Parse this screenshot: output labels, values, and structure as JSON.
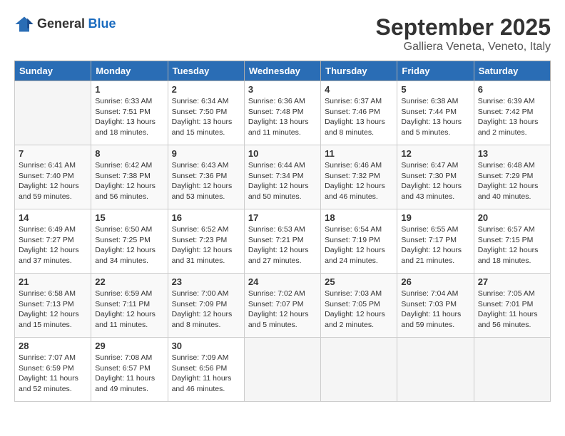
{
  "logo": {
    "general": "General",
    "blue": "Blue"
  },
  "title": "September 2025",
  "location": "Galliera Veneta, Veneto, Italy",
  "days_header": [
    "Sunday",
    "Monday",
    "Tuesday",
    "Wednesday",
    "Thursday",
    "Friday",
    "Saturday"
  ],
  "weeks": [
    [
      {
        "day": "",
        "info": ""
      },
      {
        "day": "1",
        "info": "Sunrise: 6:33 AM\nSunset: 7:51 PM\nDaylight: 13 hours\nand 18 minutes."
      },
      {
        "day": "2",
        "info": "Sunrise: 6:34 AM\nSunset: 7:50 PM\nDaylight: 13 hours\nand 15 minutes."
      },
      {
        "day": "3",
        "info": "Sunrise: 6:36 AM\nSunset: 7:48 PM\nDaylight: 13 hours\nand 11 minutes."
      },
      {
        "day": "4",
        "info": "Sunrise: 6:37 AM\nSunset: 7:46 PM\nDaylight: 13 hours\nand 8 minutes."
      },
      {
        "day": "5",
        "info": "Sunrise: 6:38 AM\nSunset: 7:44 PM\nDaylight: 13 hours\nand 5 minutes."
      },
      {
        "day": "6",
        "info": "Sunrise: 6:39 AM\nSunset: 7:42 PM\nDaylight: 13 hours\nand 2 minutes."
      }
    ],
    [
      {
        "day": "7",
        "info": "Sunrise: 6:41 AM\nSunset: 7:40 PM\nDaylight: 12 hours\nand 59 minutes."
      },
      {
        "day": "8",
        "info": "Sunrise: 6:42 AM\nSunset: 7:38 PM\nDaylight: 12 hours\nand 56 minutes."
      },
      {
        "day": "9",
        "info": "Sunrise: 6:43 AM\nSunset: 7:36 PM\nDaylight: 12 hours\nand 53 minutes."
      },
      {
        "day": "10",
        "info": "Sunrise: 6:44 AM\nSunset: 7:34 PM\nDaylight: 12 hours\nand 50 minutes."
      },
      {
        "day": "11",
        "info": "Sunrise: 6:46 AM\nSunset: 7:32 PM\nDaylight: 12 hours\nand 46 minutes."
      },
      {
        "day": "12",
        "info": "Sunrise: 6:47 AM\nSunset: 7:30 PM\nDaylight: 12 hours\nand 43 minutes."
      },
      {
        "day": "13",
        "info": "Sunrise: 6:48 AM\nSunset: 7:29 PM\nDaylight: 12 hours\nand 40 minutes."
      }
    ],
    [
      {
        "day": "14",
        "info": "Sunrise: 6:49 AM\nSunset: 7:27 PM\nDaylight: 12 hours\nand 37 minutes."
      },
      {
        "day": "15",
        "info": "Sunrise: 6:50 AM\nSunset: 7:25 PM\nDaylight: 12 hours\nand 34 minutes."
      },
      {
        "day": "16",
        "info": "Sunrise: 6:52 AM\nSunset: 7:23 PM\nDaylight: 12 hours\nand 31 minutes."
      },
      {
        "day": "17",
        "info": "Sunrise: 6:53 AM\nSunset: 7:21 PM\nDaylight: 12 hours\nand 27 minutes."
      },
      {
        "day": "18",
        "info": "Sunrise: 6:54 AM\nSunset: 7:19 PM\nDaylight: 12 hours\nand 24 minutes."
      },
      {
        "day": "19",
        "info": "Sunrise: 6:55 AM\nSunset: 7:17 PM\nDaylight: 12 hours\nand 21 minutes."
      },
      {
        "day": "20",
        "info": "Sunrise: 6:57 AM\nSunset: 7:15 PM\nDaylight: 12 hours\nand 18 minutes."
      }
    ],
    [
      {
        "day": "21",
        "info": "Sunrise: 6:58 AM\nSunset: 7:13 PM\nDaylight: 12 hours\nand 15 minutes."
      },
      {
        "day": "22",
        "info": "Sunrise: 6:59 AM\nSunset: 7:11 PM\nDaylight: 12 hours\nand 11 minutes."
      },
      {
        "day": "23",
        "info": "Sunrise: 7:00 AM\nSunset: 7:09 PM\nDaylight: 12 hours\nand 8 minutes."
      },
      {
        "day": "24",
        "info": "Sunrise: 7:02 AM\nSunset: 7:07 PM\nDaylight: 12 hours\nand 5 minutes."
      },
      {
        "day": "25",
        "info": "Sunrise: 7:03 AM\nSunset: 7:05 PM\nDaylight: 12 hours\nand 2 minutes."
      },
      {
        "day": "26",
        "info": "Sunrise: 7:04 AM\nSunset: 7:03 PM\nDaylight: 11 hours\nand 59 minutes."
      },
      {
        "day": "27",
        "info": "Sunrise: 7:05 AM\nSunset: 7:01 PM\nDaylight: 11 hours\nand 56 minutes."
      }
    ],
    [
      {
        "day": "28",
        "info": "Sunrise: 7:07 AM\nSunset: 6:59 PM\nDaylight: 11 hours\nand 52 minutes."
      },
      {
        "day": "29",
        "info": "Sunrise: 7:08 AM\nSunset: 6:57 PM\nDaylight: 11 hours\nand 49 minutes."
      },
      {
        "day": "30",
        "info": "Sunrise: 7:09 AM\nSunset: 6:56 PM\nDaylight: 11 hours\nand 46 minutes."
      },
      {
        "day": "",
        "info": ""
      },
      {
        "day": "",
        "info": ""
      },
      {
        "day": "",
        "info": ""
      },
      {
        "day": "",
        "info": ""
      }
    ]
  ]
}
